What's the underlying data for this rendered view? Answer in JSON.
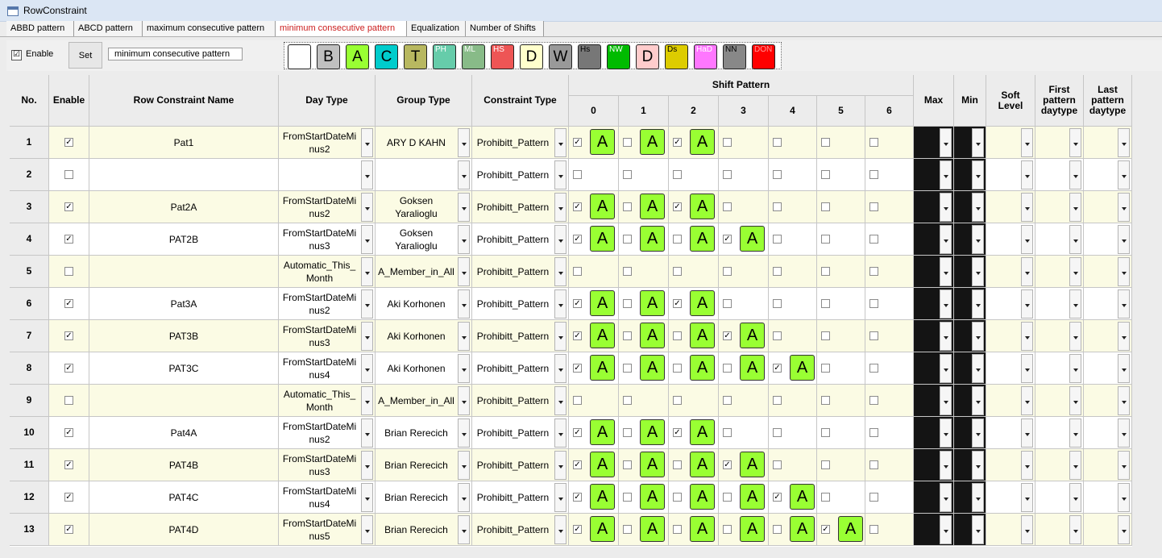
{
  "window": {
    "title": "RowConstraint"
  },
  "tabs": [
    {
      "label": "ABBD pattern"
    },
    {
      "label": "ABCD pattern"
    },
    {
      "label": "maximum consecutive pattern"
    },
    {
      "label": "minimum consecutive pattern",
      "active": true
    },
    {
      "label": "Equalization"
    },
    {
      "label": "Number of Shifts"
    }
  ],
  "toolbar": {
    "enable_checked": "☑",
    "enable_label": "Enable",
    "set_label": "Set",
    "name_value": "minimum consecutive pattern"
  },
  "palette": [
    {
      "label": "",
      "bg": "#ffffff",
      "fg": "#000000",
      "size": "big"
    },
    {
      "label": "B",
      "bg": "#c0c0c0",
      "fg": "#000000",
      "size": "big"
    },
    {
      "label": "A",
      "bg": "#99ff33",
      "fg": "#000000",
      "size": "big"
    },
    {
      "label": "C",
      "bg": "#00cccc",
      "fg": "#000000",
      "size": "big"
    },
    {
      "label": "T",
      "bg": "#b8b860",
      "fg": "#000000",
      "size": "big"
    },
    {
      "label": "PH",
      "bg": "#66ccaa",
      "fg": "#ffffff",
      "size": "small"
    },
    {
      "label": "ML",
      "bg": "#88bb88",
      "fg": "#ffffff",
      "size": "small"
    },
    {
      "label": "HS",
      "bg": "#ee5555",
      "fg": "#ffffff",
      "size": "small"
    },
    {
      "label": "D",
      "bg": "#ffffcc",
      "fg": "#000000",
      "size": "big"
    },
    {
      "label": "W",
      "bg": "#999999",
      "fg": "#000000",
      "size": "big"
    },
    {
      "label": "Hs",
      "bg": "#777777",
      "fg": "#000000",
      "size": "small"
    },
    {
      "label": "NW",
      "bg": "#00bb00",
      "fg": "#ffffff",
      "size": "small"
    },
    {
      "label": "D",
      "bg": "#ffcccc",
      "fg": "#000000",
      "size": "big"
    },
    {
      "label": "Ds",
      "bg": "#ddcc00",
      "fg": "#000000",
      "size": "small"
    },
    {
      "label": "HaD",
      "bg": "#ff77ff",
      "fg": "#ffffff",
      "size": "small"
    },
    {
      "label": "NN",
      "bg": "#888888",
      "fg": "#000000",
      "size": "small"
    },
    {
      "label": "DON",
      "bg": "#ff0000",
      "fg": "#ff9999",
      "size": "small"
    }
  ],
  "table": {
    "headers": {
      "no": "No.",
      "enable": "Enable",
      "name": "Row Constraint Name",
      "day_type": "Day Type",
      "group_type": "Group Type",
      "constraint_type": "Constraint Type",
      "shift_pattern": "Shift Pattern",
      "shift_cols": [
        "0",
        "1",
        "2",
        "3",
        "4",
        "5",
        "6"
      ],
      "max": "Max",
      "min": "Min",
      "soft_level": "Soft\nLevel",
      "first_daytype": "First\npattern\ndaytype",
      "last_daytype": "Last\npattern\ndaytype"
    },
    "rows": [
      {
        "no": "1",
        "enabled": true,
        "name": "Pat1",
        "day_type": "FromStartDateMi\nnus2",
        "group": "ARY D KAHN",
        "constraint": "Prohibitt_Pattern",
        "slots": [
          [
            "☑",
            "A"
          ],
          [
            "☐",
            "A"
          ],
          [
            "☑",
            "A"
          ],
          [
            "☐",
            ""
          ],
          [
            "☐",
            ""
          ],
          [
            "☐",
            ""
          ],
          [
            "☐",
            ""
          ]
        ]
      },
      {
        "no": "2",
        "enabled": false,
        "name": "",
        "day_type": "",
        "group": "",
        "constraint": "Prohibitt_Pattern",
        "slots": [
          [
            "☐",
            ""
          ],
          [
            "☐",
            ""
          ],
          [
            "☐",
            ""
          ],
          [
            "☐",
            ""
          ],
          [
            "☐",
            ""
          ],
          [
            "☐",
            ""
          ],
          [
            "☐",
            ""
          ]
        ]
      },
      {
        "no": "3",
        "enabled": true,
        "name": "Pat2A",
        "day_type": "FromStartDateMi\nnus2",
        "group": "Goksen\nYaralioglu",
        "constraint": "Prohibitt_Pattern",
        "slots": [
          [
            "☑",
            "A"
          ],
          [
            "☐",
            "A"
          ],
          [
            "☑",
            "A"
          ],
          [
            "☐",
            ""
          ],
          [
            "☐",
            ""
          ],
          [
            "☐",
            ""
          ],
          [
            "☐",
            ""
          ]
        ]
      },
      {
        "no": "4",
        "enabled": true,
        "name": "PAT2B",
        "day_type": "FromStartDateMi\nnus3",
        "group": "Goksen\nYaralioglu",
        "constraint": "Prohibitt_Pattern",
        "slots": [
          [
            "☑",
            "A"
          ],
          [
            "☐",
            "A"
          ],
          [
            "☐",
            "A"
          ],
          [
            "☑",
            "A"
          ],
          [
            "☐",
            ""
          ],
          [
            "☐",
            ""
          ],
          [
            "☐",
            ""
          ]
        ]
      },
      {
        "no": "5",
        "enabled": false,
        "name": "",
        "day_type": "Automatic_This_\nMonth",
        "group": "A_Member_in_All",
        "constraint": "Prohibitt_Pattern",
        "slots": [
          [
            "☐",
            ""
          ],
          [
            "☐",
            ""
          ],
          [
            "☐",
            ""
          ],
          [
            "☐",
            ""
          ],
          [
            "☐",
            ""
          ],
          [
            "☐",
            ""
          ],
          [
            "☐",
            ""
          ]
        ]
      },
      {
        "no": "6",
        "enabled": true,
        "name": "Pat3A",
        "day_type": "FromStartDateMi\nnus2",
        "group": "Aki Korhonen",
        "constraint": "Prohibitt_Pattern",
        "slots": [
          [
            "☑",
            "A"
          ],
          [
            "☐",
            "A"
          ],
          [
            "☑",
            "A"
          ],
          [
            "☐",
            ""
          ],
          [
            "☐",
            ""
          ],
          [
            "☐",
            ""
          ],
          [
            "☐",
            ""
          ]
        ]
      },
      {
        "no": "7",
        "enabled": true,
        "name": "PAT3B",
        "day_type": "FromStartDateMi\nnus3",
        "group": "Aki Korhonen",
        "constraint": "Prohibitt_Pattern",
        "slots": [
          [
            "☑",
            "A"
          ],
          [
            "☐",
            "A"
          ],
          [
            "☐",
            "A"
          ],
          [
            "☑",
            "A"
          ],
          [
            "☐",
            ""
          ],
          [
            "☐",
            ""
          ],
          [
            "☐",
            ""
          ]
        ]
      },
      {
        "no": "8",
        "enabled": true,
        "name": "PAT3C",
        "day_type": "FromStartDateMi\nnus4",
        "group": "Aki Korhonen",
        "constraint": "Prohibitt_Pattern",
        "slots": [
          [
            "☑",
            "A"
          ],
          [
            "☐",
            "A"
          ],
          [
            "☐",
            "A"
          ],
          [
            "☐",
            "A"
          ],
          [
            "☑",
            "A"
          ],
          [
            "☐",
            ""
          ],
          [
            "☐",
            ""
          ]
        ]
      },
      {
        "no": "9",
        "enabled": false,
        "name": "",
        "day_type": "Automatic_This_\nMonth",
        "group": "A_Member_in_All",
        "constraint": "Prohibitt_Pattern",
        "slots": [
          [
            "☐",
            ""
          ],
          [
            "☐",
            ""
          ],
          [
            "☐",
            ""
          ],
          [
            "☐",
            ""
          ],
          [
            "☐",
            ""
          ],
          [
            "☐",
            ""
          ],
          [
            "☐",
            ""
          ]
        ]
      },
      {
        "no": "10",
        "enabled": true,
        "name": "Pat4A",
        "day_type": "FromStartDateMi\nnus2",
        "group": "Brian Rerecich",
        "constraint": "Prohibitt_Pattern",
        "slots": [
          [
            "☑",
            "A"
          ],
          [
            "☐",
            "A"
          ],
          [
            "☑",
            "A"
          ],
          [
            "☐",
            ""
          ],
          [
            "☐",
            ""
          ],
          [
            "☐",
            ""
          ],
          [
            "☐",
            ""
          ]
        ]
      },
      {
        "no": "11",
        "enabled": true,
        "name": "PAT4B",
        "day_type": "FromStartDateMi\nnus3",
        "group": "Brian Rerecich",
        "constraint": "Prohibitt_Pattern",
        "slots": [
          [
            "☑",
            "A"
          ],
          [
            "☐",
            "A"
          ],
          [
            "☐",
            "A"
          ],
          [
            "☑",
            "A"
          ],
          [
            "☐",
            ""
          ],
          [
            "☐",
            ""
          ],
          [
            "☐",
            ""
          ]
        ]
      },
      {
        "no": "12",
        "enabled": true,
        "name": "PAT4C",
        "day_type": "FromStartDateMi\nnus4",
        "group": "Brian Rerecich",
        "constraint": "Prohibitt_Pattern",
        "slots": [
          [
            "☑",
            "A"
          ],
          [
            "☐",
            "A"
          ],
          [
            "☐",
            "A"
          ],
          [
            "☐",
            "A"
          ],
          [
            "☑",
            "A"
          ],
          [
            "☐",
            ""
          ],
          [
            "☐",
            ""
          ]
        ]
      },
      {
        "no": "13",
        "enabled": true,
        "name": "PAT4D",
        "day_type": "FromStartDateMi\nnus5",
        "group": "Brian Rerecich",
        "constraint": "Prohibitt_Pattern",
        "slots": [
          [
            "☑",
            "A"
          ],
          [
            "☐",
            "A"
          ],
          [
            "☐",
            "A"
          ],
          [
            "☐",
            "A"
          ],
          [
            "☐",
            "A"
          ],
          [
            "☑",
            "A"
          ],
          [
            "☐",
            ""
          ]
        ]
      }
    ]
  },
  "colors": {
    "odd_row_bg": "#fbfbe4",
    "even_row_bg": "#ffffff",
    "shift_a_bg": "#99ff33",
    "maxmin_bg": "#141414",
    "active_tab_text": "#cc2020"
  },
  "marks": {
    "checked": "☑",
    "unchecked": "☐"
  }
}
